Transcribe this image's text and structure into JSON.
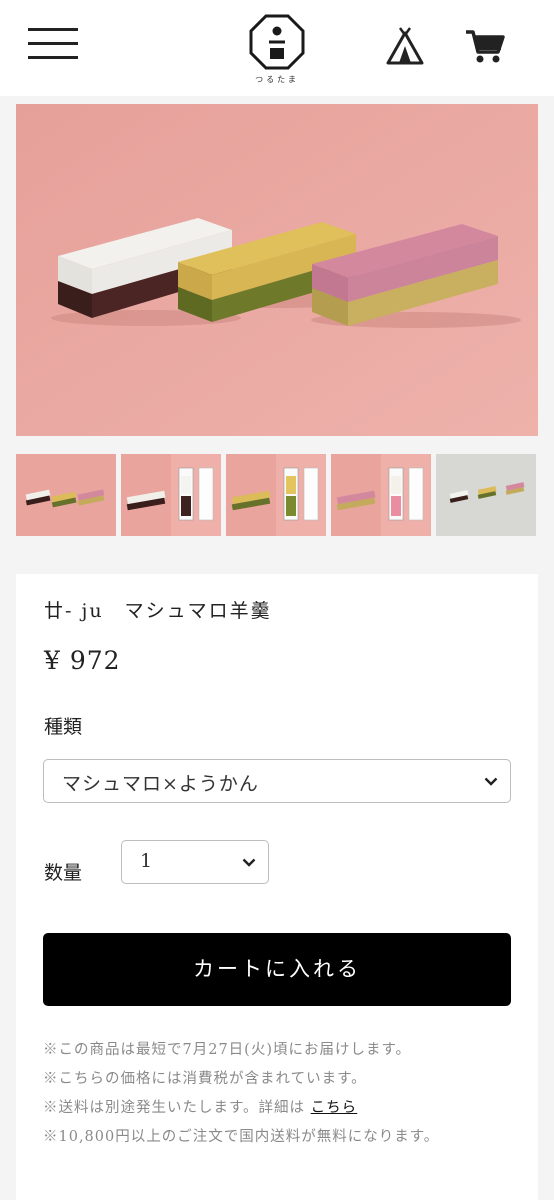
{
  "header": {
    "menu_icon": "hamburger-menu-icon",
    "logo_text": "つるたま",
    "tent_icon": "tent-icon",
    "cart_icon": "cart-icon"
  },
  "product": {
    "name": "廿- ju　マシュマロ羊羹",
    "price": "¥ 972",
    "variety": {
      "label": "種類",
      "selected": "マシュマロ×ようかん"
    },
    "quantity": {
      "label": "数量",
      "selected": "1"
    },
    "add_to_cart_label": "カートに入れる"
  },
  "notes": {
    "line1": "※この商品は最短で7月27日(火)頃にお届けします。",
    "line2": "※こちらの価格には消費税が含まれています。",
    "line3_prefix": "※送料は別途発生いたします。詳細は",
    "line3_link": "こちら",
    "line4": "※10,800円以上のご注文で国内送料が無料になります。"
  },
  "colors": {
    "background_pink": "#e9a7a0",
    "button_black": "#000000",
    "note_gray": "#8a8a8a"
  }
}
